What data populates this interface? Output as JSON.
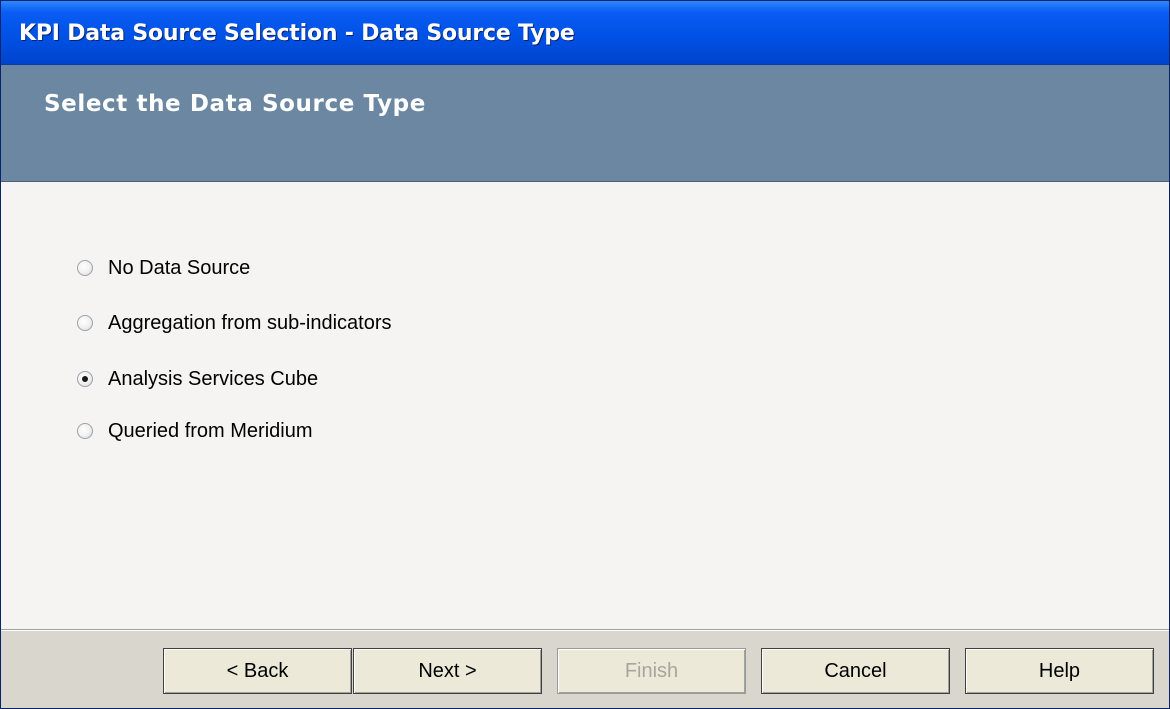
{
  "window": {
    "title": "KPI Data Source Selection - Data Source Type"
  },
  "banner": {
    "heading": "Select the Data Source Type"
  },
  "options": [
    {
      "label": "No Data Source",
      "checked": false
    },
    {
      "label": "Aggregation from sub-indicators",
      "checked": false
    },
    {
      "label": "Analysis Services Cube",
      "checked": true
    },
    {
      "label": "Queried from Meridium",
      "checked": false
    }
  ],
  "buttons": {
    "back": "< Back",
    "next": "Next >",
    "finish": "Finish",
    "cancel": "Cancel",
    "help": "Help"
  },
  "colors": {
    "titlebar": "#0052e6",
    "banner": "#6b87a1",
    "content": "#f5f4f2",
    "footer": "#d9d6ce"
  }
}
